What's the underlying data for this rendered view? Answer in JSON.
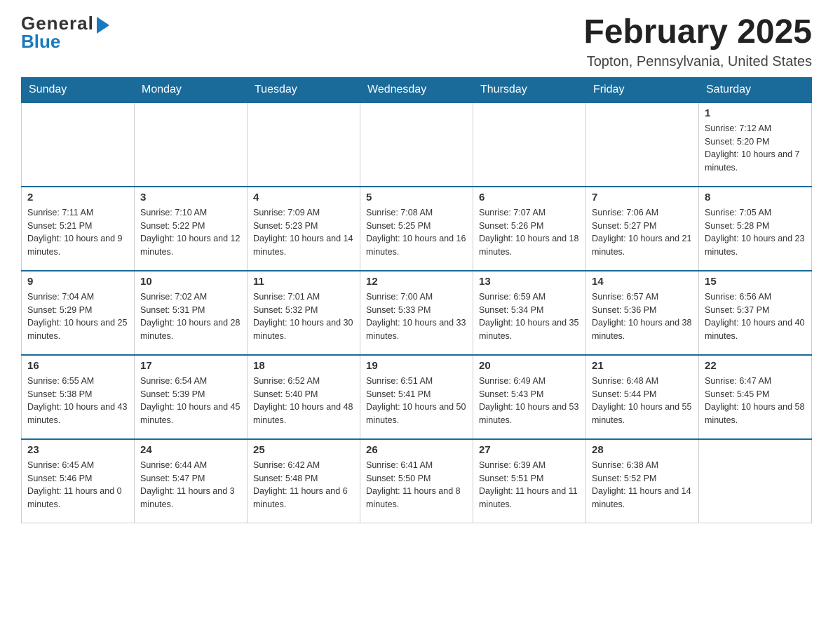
{
  "header": {
    "logo_general": "General",
    "logo_blue": "Blue",
    "month_year": "February 2025",
    "location": "Topton, Pennsylvania, United States"
  },
  "days_of_week": [
    "Sunday",
    "Monday",
    "Tuesday",
    "Wednesday",
    "Thursday",
    "Friday",
    "Saturday"
  ],
  "weeks": [
    {
      "days": [
        {
          "num": "",
          "sunrise": "",
          "sunset": "",
          "daylight": ""
        },
        {
          "num": "",
          "sunrise": "",
          "sunset": "",
          "daylight": ""
        },
        {
          "num": "",
          "sunrise": "",
          "sunset": "",
          "daylight": ""
        },
        {
          "num": "",
          "sunrise": "",
          "sunset": "",
          "daylight": ""
        },
        {
          "num": "",
          "sunrise": "",
          "sunset": "",
          "daylight": ""
        },
        {
          "num": "",
          "sunrise": "",
          "sunset": "",
          "daylight": ""
        },
        {
          "num": "1",
          "sunrise": "Sunrise: 7:12 AM",
          "sunset": "Sunset: 5:20 PM",
          "daylight": "Daylight: 10 hours and 7 minutes."
        }
      ]
    },
    {
      "days": [
        {
          "num": "2",
          "sunrise": "Sunrise: 7:11 AM",
          "sunset": "Sunset: 5:21 PM",
          "daylight": "Daylight: 10 hours and 9 minutes."
        },
        {
          "num": "3",
          "sunrise": "Sunrise: 7:10 AM",
          "sunset": "Sunset: 5:22 PM",
          "daylight": "Daylight: 10 hours and 12 minutes."
        },
        {
          "num": "4",
          "sunrise": "Sunrise: 7:09 AM",
          "sunset": "Sunset: 5:23 PM",
          "daylight": "Daylight: 10 hours and 14 minutes."
        },
        {
          "num": "5",
          "sunrise": "Sunrise: 7:08 AM",
          "sunset": "Sunset: 5:25 PM",
          "daylight": "Daylight: 10 hours and 16 minutes."
        },
        {
          "num": "6",
          "sunrise": "Sunrise: 7:07 AM",
          "sunset": "Sunset: 5:26 PM",
          "daylight": "Daylight: 10 hours and 18 minutes."
        },
        {
          "num": "7",
          "sunrise": "Sunrise: 7:06 AM",
          "sunset": "Sunset: 5:27 PM",
          "daylight": "Daylight: 10 hours and 21 minutes."
        },
        {
          "num": "8",
          "sunrise": "Sunrise: 7:05 AM",
          "sunset": "Sunset: 5:28 PM",
          "daylight": "Daylight: 10 hours and 23 minutes."
        }
      ]
    },
    {
      "days": [
        {
          "num": "9",
          "sunrise": "Sunrise: 7:04 AM",
          "sunset": "Sunset: 5:29 PM",
          "daylight": "Daylight: 10 hours and 25 minutes."
        },
        {
          "num": "10",
          "sunrise": "Sunrise: 7:02 AM",
          "sunset": "Sunset: 5:31 PM",
          "daylight": "Daylight: 10 hours and 28 minutes."
        },
        {
          "num": "11",
          "sunrise": "Sunrise: 7:01 AM",
          "sunset": "Sunset: 5:32 PM",
          "daylight": "Daylight: 10 hours and 30 minutes."
        },
        {
          "num": "12",
          "sunrise": "Sunrise: 7:00 AM",
          "sunset": "Sunset: 5:33 PM",
          "daylight": "Daylight: 10 hours and 33 minutes."
        },
        {
          "num": "13",
          "sunrise": "Sunrise: 6:59 AM",
          "sunset": "Sunset: 5:34 PM",
          "daylight": "Daylight: 10 hours and 35 minutes."
        },
        {
          "num": "14",
          "sunrise": "Sunrise: 6:57 AM",
          "sunset": "Sunset: 5:36 PM",
          "daylight": "Daylight: 10 hours and 38 minutes."
        },
        {
          "num": "15",
          "sunrise": "Sunrise: 6:56 AM",
          "sunset": "Sunset: 5:37 PM",
          "daylight": "Daylight: 10 hours and 40 minutes."
        }
      ]
    },
    {
      "days": [
        {
          "num": "16",
          "sunrise": "Sunrise: 6:55 AM",
          "sunset": "Sunset: 5:38 PM",
          "daylight": "Daylight: 10 hours and 43 minutes."
        },
        {
          "num": "17",
          "sunrise": "Sunrise: 6:54 AM",
          "sunset": "Sunset: 5:39 PM",
          "daylight": "Daylight: 10 hours and 45 minutes."
        },
        {
          "num": "18",
          "sunrise": "Sunrise: 6:52 AM",
          "sunset": "Sunset: 5:40 PM",
          "daylight": "Daylight: 10 hours and 48 minutes."
        },
        {
          "num": "19",
          "sunrise": "Sunrise: 6:51 AM",
          "sunset": "Sunset: 5:41 PM",
          "daylight": "Daylight: 10 hours and 50 minutes."
        },
        {
          "num": "20",
          "sunrise": "Sunrise: 6:49 AM",
          "sunset": "Sunset: 5:43 PM",
          "daylight": "Daylight: 10 hours and 53 minutes."
        },
        {
          "num": "21",
          "sunrise": "Sunrise: 6:48 AM",
          "sunset": "Sunset: 5:44 PM",
          "daylight": "Daylight: 10 hours and 55 minutes."
        },
        {
          "num": "22",
          "sunrise": "Sunrise: 6:47 AM",
          "sunset": "Sunset: 5:45 PM",
          "daylight": "Daylight: 10 hours and 58 minutes."
        }
      ]
    },
    {
      "days": [
        {
          "num": "23",
          "sunrise": "Sunrise: 6:45 AM",
          "sunset": "Sunset: 5:46 PM",
          "daylight": "Daylight: 11 hours and 0 minutes."
        },
        {
          "num": "24",
          "sunrise": "Sunrise: 6:44 AM",
          "sunset": "Sunset: 5:47 PM",
          "daylight": "Daylight: 11 hours and 3 minutes."
        },
        {
          "num": "25",
          "sunrise": "Sunrise: 6:42 AM",
          "sunset": "Sunset: 5:48 PM",
          "daylight": "Daylight: 11 hours and 6 minutes."
        },
        {
          "num": "26",
          "sunrise": "Sunrise: 6:41 AM",
          "sunset": "Sunset: 5:50 PM",
          "daylight": "Daylight: 11 hours and 8 minutes."
        },
        {
          "num": "27",
          "sunrise": "Sunrise: 6:39 AM",
          "sunset": "Sunset: 5:51 PM",
          "daylight": "Daylight: 11 hours and 11 minutes."
        },
        {
          "num": "28",
          "sunrise": "Sunrise: 6:38 AM",
          "sunset": "Sunset: 5:52 PM",
          "daylight": "Daylight: 11 hours and 14 minutes."
        },
        {
          "num": "",
          "sunrise": "",
          "sunset": "",
          "daylight": ""
        }
      ]
    }
  ]
}
